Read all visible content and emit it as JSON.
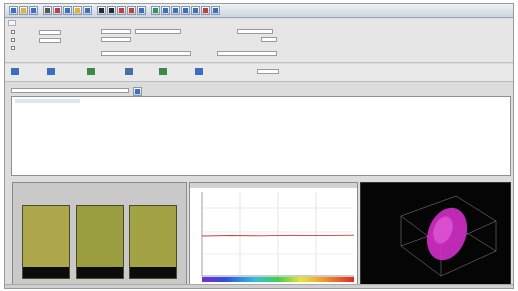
{
  "toolbar": {
    "icons": [
      "new-icon",
      "open-icon",
      "save-icon",
      "print-icon",
      "cut-icon",
      "copy-icon",
      "paste-icon",
      "undo-icon",
      "measure-icon",
      "scan-icon",
      "chart-icon",
      "target-icon",
      "settings-icon",
      "color-icon",
      "grid-icon",
      "export-icon",
      "help-icon",
      "info-icon",
      "zoom-icon",
      "window-icon"
    ],
    "colors": [
      "#3b6fc4",
      "#e0b23c",
      "#3b6fc4",
      "#555555",
      "#c04040",
      "#3b6fc4",
      "#e0b23c",
      "#3b6fc4",
      "#2a2a2a",
      "#2a2a2a",
      "#c04040",
      "#c04040",
      "#3b6fc4",
      "#2f9a4a",
      "#3b6fc4",
      "#3b6fc4",
      "#3b6fc4",
      "#3b6fc4",
      "#c04040",
      "#3b6fc4"
    ]
  },
  "panel": {
    "tab": "",
    "checks": [
      "",
      "",
      ""
    ]
  },
  "actions": {
    "items": [
      {
        "label": "",
        "icon": "measure-icon"
      },
      {
        "label": "",
        "icon": "standard-icon"
      },
      {
        "label": "",
        "icon": "sample-icon"
      },
      {
        "label": "",
        "icon": "edit-icon"
      },
      {
        "label": "",
        "icon": "check-icon"
      },
      {
        "label": "",
        "icon": "delete-icon"
      }
    ],
    "dropdown_value": ""
  },
  "list": {
    "filter_value": "",
    "rows": [
      [
        "",
        "",
        "",
        "",
        "",
        "",
        "",
        "",
        "",
        "",
        "",
        "",
        ""
      ],
      [
        "",
        "",
        "",
        "",
        ""
      ],
      [
        "",
        "",
        "",
        "",
        ""
      ],
      [
        "",
        "",
        "",
        "",
        ""
      ],
      [
        "",
        "",
        "",
        "",
        ""
      ],
      [
        "",
        "",
        "",
        "",
        ""
      ],
      [
        "",
        "",
        "",
        "",
        ""
      ]
    ]
  },
  "panes": {
    "swatch_colors": [
      "#ada64a",
      "#9a9e3e",
      "#a3a244"
    ],
    "spectrum_title": "",
    "plot_title": ""
  },
  "status": {
    "left": "",
    "right": ""
  }
}
